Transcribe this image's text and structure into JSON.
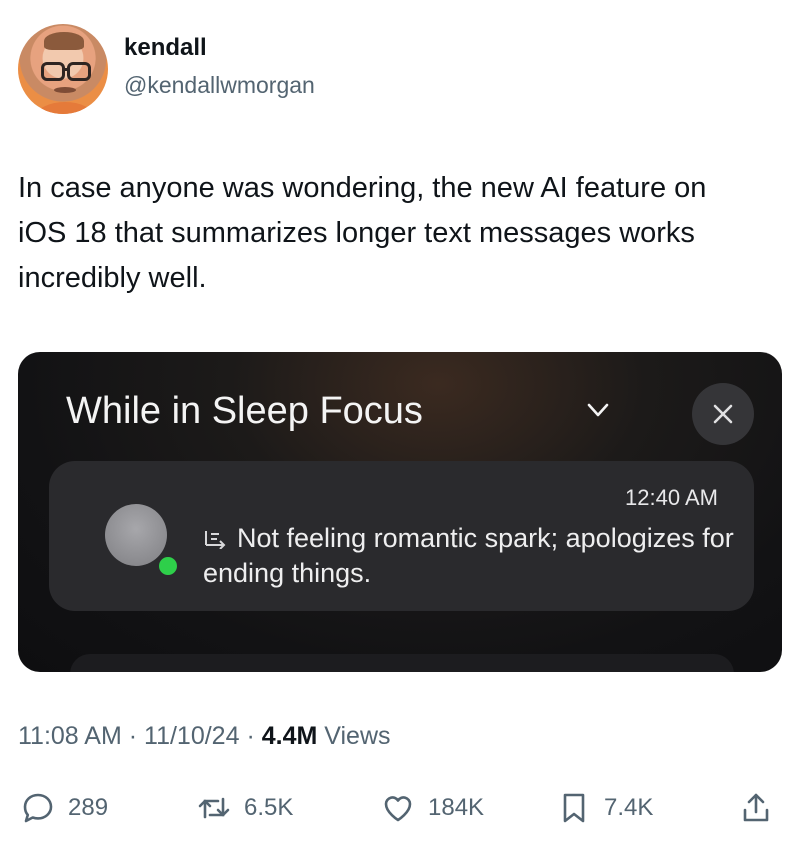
{
  "author": {
    "name": "kendall",
    "handle": "@kendallwmorgan"
  },
  "tweet": {
    "text": "In case anyone was wondering, the new AI feature on iOS 18 that summarizes longer text messages works incredibly well."
  },
  "media": {
    "header": "While in Sleep Focus",
    "notification": {
      "time": "12:40 AM",
      "summary": "Not feeling romantic spark; apologizes for ending things."
    }
  },
  "meta": {
    "time": "11:08 AM",
    "date": "11/10/24",
    "views_count": "4.4M",
    "views_label": "Views"
  },
  "actions": {
    "replies": "289",
    "reposts": "6.5K",
    "likes": "184K",
    "bookmarks": "7.4K"
  },
  "colors": {
    "text": "#0f1419",
    "muted": "#536471",
    "online_dot": "#2ecf4a"
  }
}
